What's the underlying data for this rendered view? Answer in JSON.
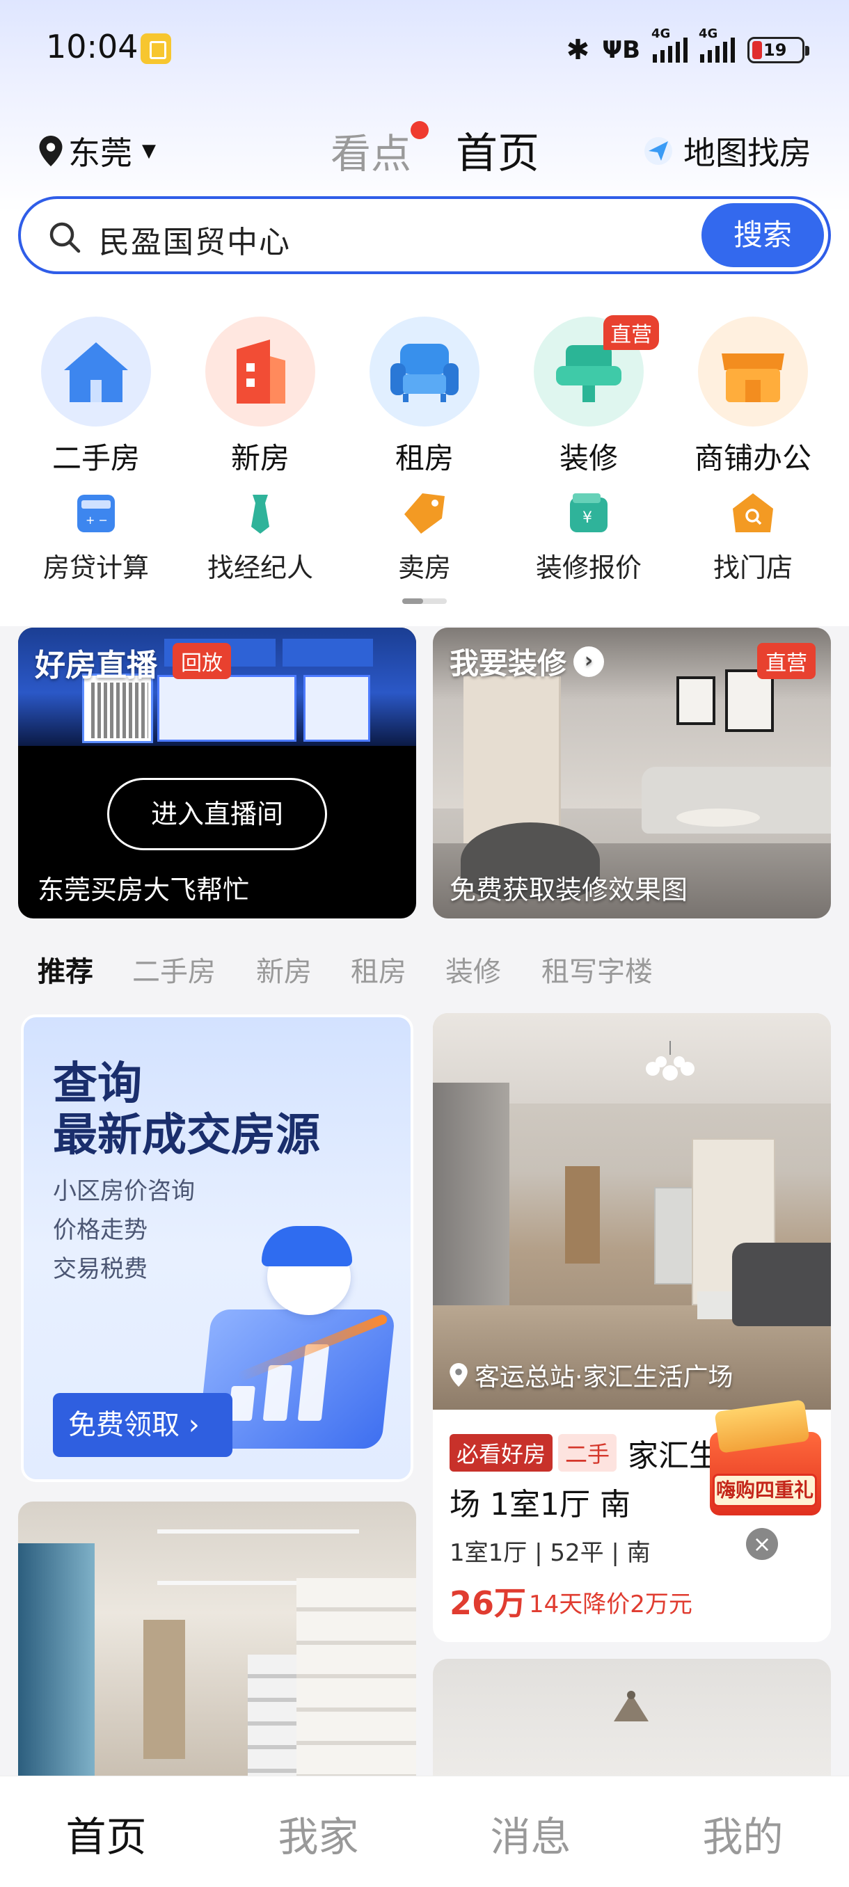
{
  "status_bar": {
    "time": "10:04",
    "network_1": "4G",
    "network_2": "4G",
    "battery": "19"
  },
  "header": {
    "city": "东莞",
    "tab_kandian": "看点",
    "tab_home": "首页",
    "map_find": "地图找房"
  },
  "search": {
    "text": "民盈国贸中心",
    "button": "搜索"
  },
  "main_grid": [
    {
      "label": "二手房",
      "icon": "house-icon",
      "color": "#3d8bf0"
    },
    {
      "label": "新房",
      "icon": "building-icon",
      "color": "#f15a3c"
    },
    {
      "label": "租房",
      "icon": "armchair-icon",
      "color": "#2f8ee8"
    },
    {
      "label": "装修",
      "icon": "sofa-chair-icon",
      "color": "#2fb39a",
      "badge": "直营"
    },
    {
      "label": "商铺办公",
      "icon": "shop-icon",
      "color": "#f39a23"
    }
  ],
  "sub_grid": [
    {
      "label": "房贷计算",
      "icon": "calculator-icon"
    },
    {
      "label": "找经纪人",
      "icon": "agent-tie-icon"
    },
    {
      "label": "卖房",
      "icon": "price-tag-icon"
    },
    {
      "label": "装修报价",
      "icon": "quote-wallet-icon"
    },
    {
      "label": "找门店",
      "icon": "store-search-icon"
    }
  ],
  "live_card": {
    "title": "好房直播",
    "badge": "回放",
    "button": "进入直播间",
    "subtitle": "东莞买房大飞帮忙"
  },
  "deco_card": {
    "title": "我要装修",
    "badge": "直营",
    "subtitle": "免费获取装修效果图"
  },
  "content_tabs": [
    "推荐",
    "二手房",
    "新房",
    "租房",
    "装修",
    "租写字楼"
  ],
  "query_card": {
    "title_line1": "查询",
    "title_line2": "最新成交房源",
    "items": [
      "小区房价咨询",
      "价格走势",
      "交易税费"
    ],
    "button": "免费领取 ›"
  },
  "house_card": {
    "location": "客运总站·家汇生活广场",
    "tag_recommend": "必看好房",
    "tag_type": "二手",
    "title_part1": "家汇生",
    "title_part2": "场 1室1厅 南",
    "info": "1室1厅 | 52平 | 南",
    "price": "26万",
    "price_drop": "14天降价2万元",
    "close_icon": "close-icon"
  },
  "promo": {
    "label": "嗨购四重礼"
  },
  "bottom_nav": [
    "首页",
    "我家",
    "消息",
    "我的"
  ]
}
